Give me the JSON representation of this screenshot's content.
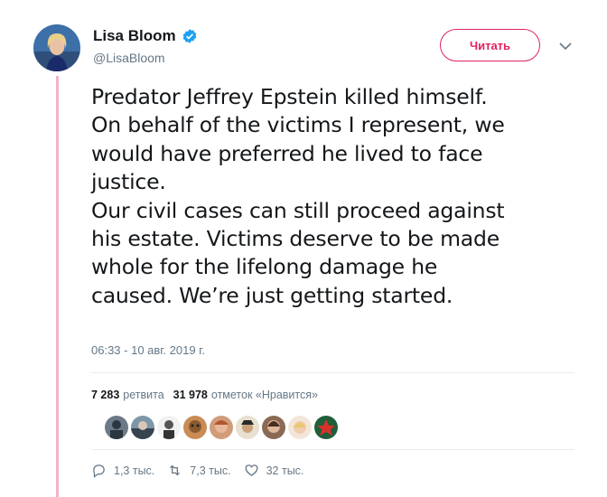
{
  "author": {
    "name": "Lisa Bloom",
    "handle": "@LisaBloom"
  },
  "follow_label": "Читать",
  "tweet_lines": [
    "Predator Jeffrey Epstein killed himself.",
    "On behalf of the victims I represent, we",
    "would have preferred he lived to face",
    "justice.",
    "Our civil cases can still proceed against",
    "his estate. Victims deserve to be made",
    "whole for the lifelong damage he",
    "caused. We’re just getting started."
  ],
  "timestamp": "06:33 - 10 авг. 2019 г.",
  "stats": {
    "retweets_count": "7 283",
    "retweets_label": "ретвита",
    "likes_count": "31 978",
    "likes_label": "отметок «Нравится»"
  },
  "actions": {
    "replies": "1,3 тыс.",
    "retweets": "7,3 тыс.",
    "likes": "32 тыс."
  },
  "colors": {
    "accent": "#e0245e",
    "verified": "#1da1f2",
    "thread_line": "#f4b3c6",
    "muted": "#657786"
  },
  "icons": [
    "verified-badge-icon",
    "chevron-down-icon",
    "reply-icon",
    "retweet-icon",
    "heart-icon"
  ]
}
